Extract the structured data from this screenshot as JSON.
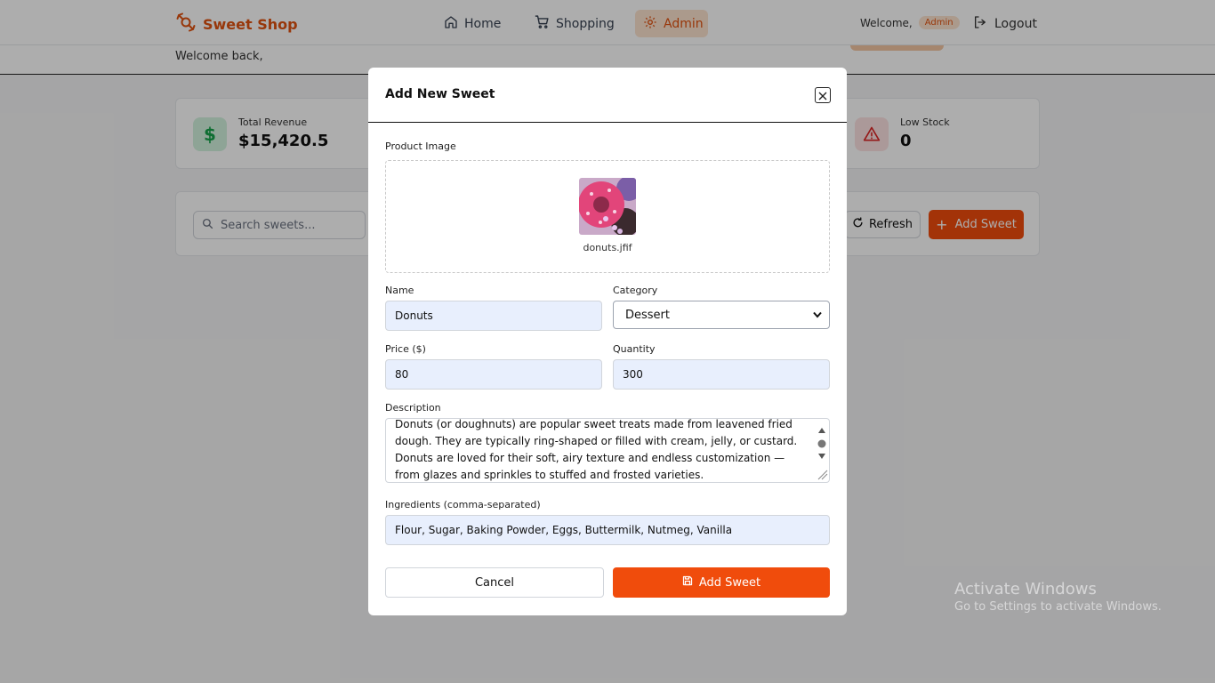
{
  "navbar": {
    "brand": "Sweet Shop",
    "links": [
      {
        "label": "Home",
        "icon": "home-icon"
      },
      {
        "label": "Shopping",
        "icon": "cart-icon"
      },
      {
        "label": "Admin",
        "icon": "gear-icon",
        "active": true
      }
    ],
    "welcome_text": "Welcome,",
    "role_badge": "Admin",
    "logout_label": "Logout"
  },
  "page": {
    "welcome_back": "Welcome back,",
    "stats": {
      "revenue_label": "Total Revenue",
      "revenue_value": "$15,420.5",
      "low_stock_label": "Low Stock",
      "low_stock_value": "0"
    },
    "toolbar": {
      "search_placeholder": "Search sweets...",
      "refresh_label": "Refresh",
      "add_sweet_label": "Add Sweet"
    }
  },
  "modal": {
    "title": "Add New Sweet",
    "image_label": "Product Image",
    "file_name": "donuts.jfif",
    "name_label": "Name",
    "name_value": "Donuts",
    "category_label": "Category",
    "category_value": "Dessert",
    "price_label": "Price ($)",
    "price_value": "80",
    "quantity_label": "Quantity",
    "quantity_value": "300",
    "description_label": "Description",
    "description_value": "Donuts (or doughnuts) are popular sweet treats made from leavened fried dough. They are typically ring-shaped or filled with cream, jelly, or custard. Donuts are loved for their soft, airy texture and endless customization — from glazes and sprinkles to stuffed and frosted varieties.",
    "ingredients_label": "Ingredients (comma-separated)",
    "ingredients_value": "Flour, Sugar, Baking Powder, Eggs, Buttermilk, Nutmeg, Vanilla",
    "cancel_label": "Cancel",
    "submit_label": "Add Sweet"
  },
  "watermark": {
    "title": "Activate Windows",
    "subtitle": "Go to Settings to activate Windows."
  },
  "colors": {
    "brand_orange": "#e0520f",
    "button_orange": "#f04c0c",
    "input_fill": "#e8effd"
  }
}
